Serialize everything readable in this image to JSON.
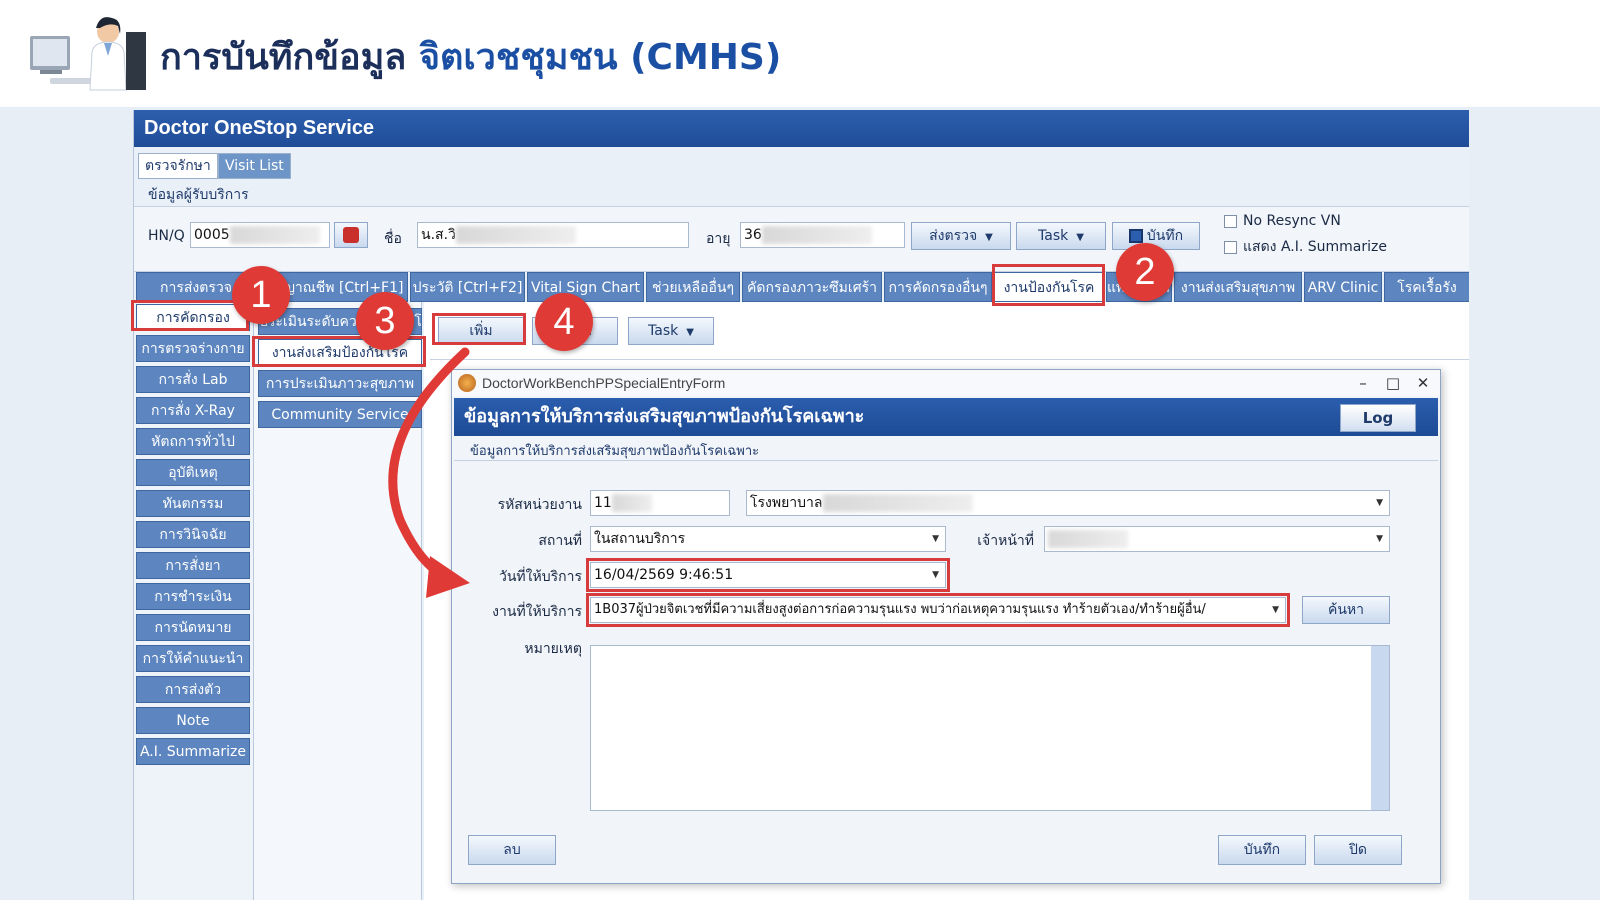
{
  "slide": {
    "title_part1": "การบันทึกข้อมูล",
    "title_part2": "จิตเวชชุมชน (CMHS)"
  },
  "app": {
    "title": "Doctor OneStop Service",
    "top_tabs": [
      "ตรวจรักษา",
      "Visit List"
    ],
    "patient_section_label": "ข้อมูลผู้รับบริการ",
    "hn_label": "HN/Q",
    "hn_value": "0005",
    "name_label": "ชื่อ",
    "name_value": "น.ส.วิ",
    "age_label": "อายุ",
    "age_value": "36",
    "send_btn": "ส่งตรวจ",
    "task_btn": "Task",
    "save_btn": "บันทึก",
    "no_resync": "No Resync VN",
    "ai_summarize_chk": "แสดง A.I. Summarize"
  },
  "main_tabs": [
    "การส่งตรวจ",
    "สัญญาณชีพ [Ctrl+F1]",
    "ประวัติ [Ctrl+F2]",
    "Vital Sign Chart",
    "ช่วยเหลืออื่นๆ",
    "คัดกรองภาวะซึมเศร้า",
    "การคัดกรองอื่นๆ",
    "งานป้องกันโรค",
    "แพทย์แผนไทย",
    "งานส่งเสริมสุขภาพ",
    "ARV Clinic",
    "โรคเรื้อรัง"
  ],
  "sidebar": [
    "การคัดกรอง",
    "การตรวจร่างกาย",
    "การสั่ง Lab",
    "การสั่ง X-Ray",
    "หัตถการทั่วไป",
    "อุบัติเหตุ",
    "ทันตกรรม",
    "การวินิจฉัย",
    "การสั่งยา",
    "การชำระเงิน",
    "การนัดหมาย",
    "การให้คำแนะนำ",
    "การส่งตัว",
    "Note",
    "A.I. Summarize"
  ],
  "submenu": [
    "ประเมินระดับความรุนแรงโรค",
    "งานส่งเสริมป้องกันโรค",
    "การประเมินภาวะสุขภาพ",
    "Community Service"
  ],
  "work_toolbar": {
    "add_btn": "เพิ่ม",
    "edit_btn": "แก้ไข",
    "task_btn": "Task"
  },
  "dialog": {
    "window_title": "DoctorWorkBenchPPSpecialEntryForm",
    "header": "ข้อมูลการให้บริการส่งเสริมสุขภาพป้องกันโรคเฉพาะ",
    "log_btn": "Log",
    "subheader": "ข้อมูลการให้บริการส่งเสริมสุขภาพป้องกันโรคเฉพาะ",
    "unit_label": "รหัสหน่วยงาน",
    "unit_code": "11",
    "unit_name": "โรงพยาบาล",
    "place_label": "สถานที่",
    "place_value": "ในสถานบริการ",
    "staff_label": "เจ้าหน้าที่",
    "date_label": "วันที่ให้บริการ",
    "date_value": "16/04/2569 9:46:51",
    "service_label": "งานที่ให้บริการ",
    "service_value": "1B037ผู้ป่วยจิตเวชที่มีความเสี่ยงสูงต่อการก่อความรุนแรง พบว่าก่อเหตุความรุนแรง  ทำร้ายตัวเอง/ทำร้ายผู้อื่น/",
    "search_btn": "ค้นหา",
    "note_label": "หมายเหตุ",
    "delete_btn": "ลบ",
    "save_btn": "บันทึก",
    "close_btn": "ปิด"
  },
  "annotations": [
    "1",
    "2",
    "3",
    "4"
  ],
  "colors": {
    "highlight": "#d83b3b",
    "app_blue": "#1f4c97",
    "tab_blue": "#5d86c0"
  }
}
